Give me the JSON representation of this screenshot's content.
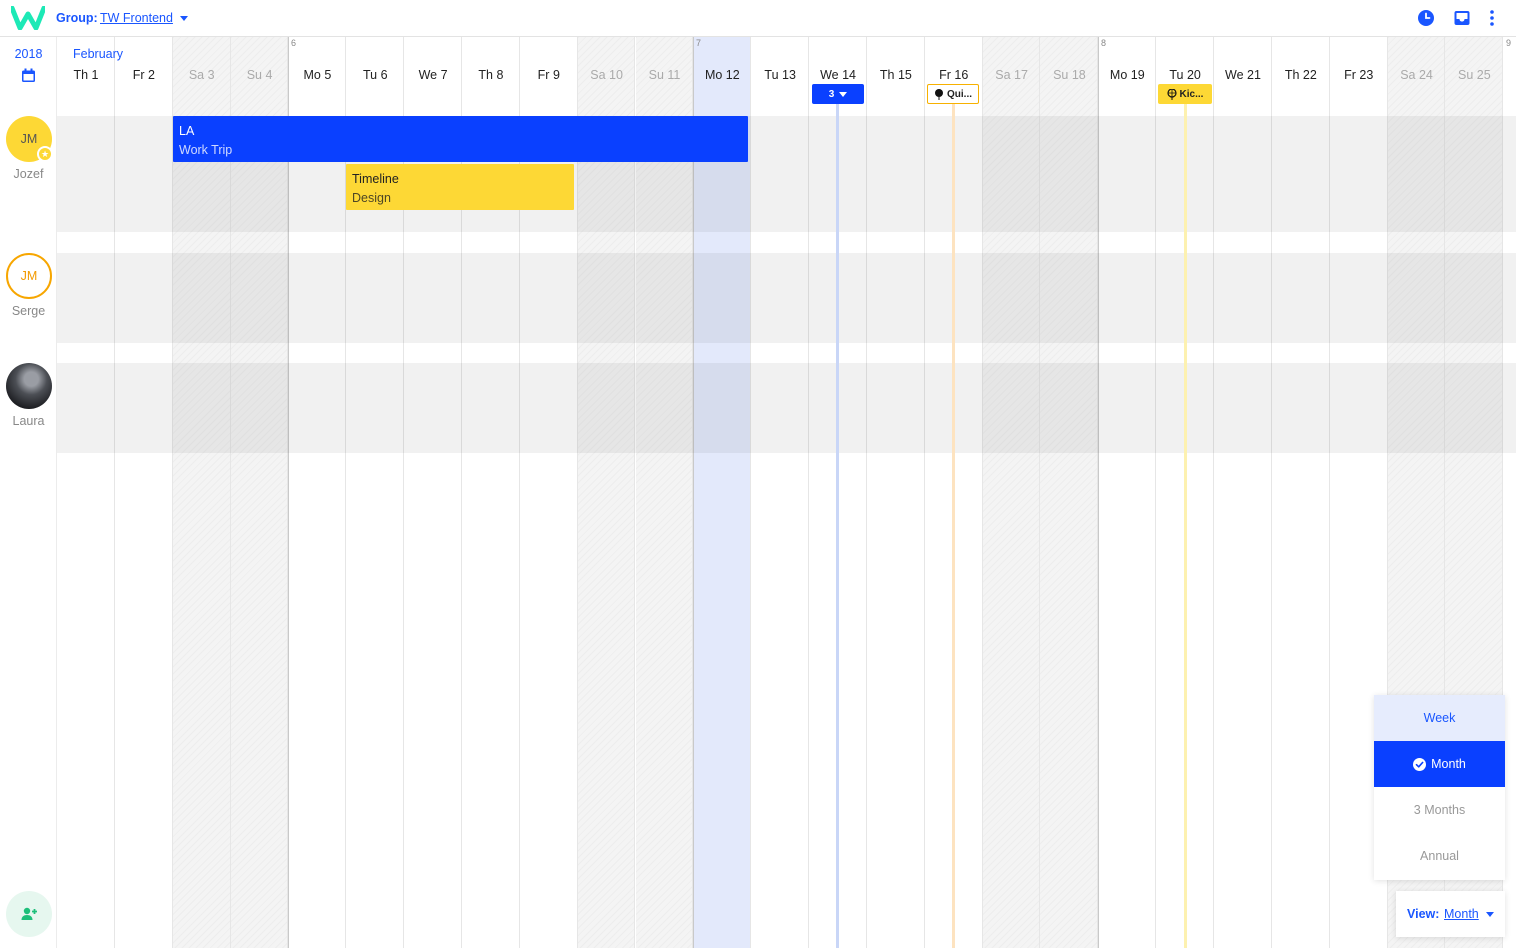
{
  "colors": {
    "accent": "#1a56ff",
    "event_blue": "#0a40ff",
    "event_yellow": "#fdd835",
    "today_highlight": "#e3e9fb",
    "logo_green": "#1de9b6"
  },
  "topbar": {
    "group_label": "Group:",
    "group_value": "TW Frontend",
    "icons": [
      "clock-icon",
      "inbox-icon",
      "more-vert-icon"
    ]
  },
  "sidebar": {
    "year": "2018",
    "people": [
      {
        "initials": "JM",
        "name": "Jozef",
        "badge": "star"
      },
      {
        "initials": "JM",
        "name": "Serge"
      },
      {
        "initials": "",
        "name": "Laura"
      }
    ]
  },
  "calendar": {
    "month": "February",
    "week_numbers": [
      "6",
      "7",
      "8",
      "9"
    ],
    "days": [
      {
        "label": "Th 1",
        "weekend": false
      },
      {
        "label": "Fr 2",
        "weekend": false
      },
      {
        "label": "Sa 3",
        "weekend": true
      },
      {
        "label": "Su 4",
        "weekend": true
      },
      {
        "label": "Mo 5",
        "weekend": false
      },
      {
        "label": "Tu 6",
        "weekend": false
      },
      {
        "label": "We 7",
        "weekend": false
      },
      {
        "label": "Th 8",
        "weekend": false
      },
      {
        "label": "Fr 9",
        "weekend": false
      },
      {
        "label": "Sa 10",
        "weekend": true
      },
      {
        "label": "Su 11",
        "weekend": true
      },
      {
        "label": "Mo 12",
        "weekend": false,
        "today": true
      },
      {
        "label": "Tu 13",
        "weekend": false
      },
      {
        "label": "We 14",
        "weekend": false
      },
      {
        "label": "Th 15",
        "weekend": false
      },
      {
        "label": "Fr 16",
        "weekend": false
      },
      {
        "label": "Sa 17",
        "weekend": true
      },
      {
        "label": "Su 18",
        "weekend": true
      },
      {
        "label": "Mo 19",
        "weekend": false
      },
      {
        "label": "Tu 20",
        "weekend": false
      },
      {
        "label": "We 21",
        "weekend": false
      },
      {
        "label": "Th 22",
        "weekend": false
      },
      {
        "label": "Fr 23",
        "weekend": false
      },
      {
        "label": "Sa 24",
        "weekend": true
      },
      {
        "label": "Su 25",
        "weekend": true
      }
    ],
    "markers": [
      {
        "day": "We 14",
        "text": "3",
        "style": "blue",
        "has_caret": true
      },
      {
        "day": "Fr 16",
        "text": "Qui...",
        "style": "outline",
        "icon": "balloon-icon"
      },
      {
        "day": "Tu 20",
        "text": "Kic...",
        "style": "yellow",
        "icon": "balloon-icon"
      }
    ],
    "events": [
      {
        "person": "Jozef",
        "title": "LA",
        "subtitle": "Work Trip",
        "color": "blue",
        "start": "Sa 3",
        "end": "Mo 12"
      },
      {
        "person": "Jozef",
        "title": "Timeline",
        "subtitle": "Design",
        "color": "yellow",
        "start": "Tu 6",
        "end": "Fr 9"
      }
    ]
  },
  "view_menu": {
    "options": [
      "Week",
      "Month",
      "3 Months",
      "Annual"
    ],
    "selected": "Month",
    "button_label": "View:",
    "button_value": "Month"
  }
}
